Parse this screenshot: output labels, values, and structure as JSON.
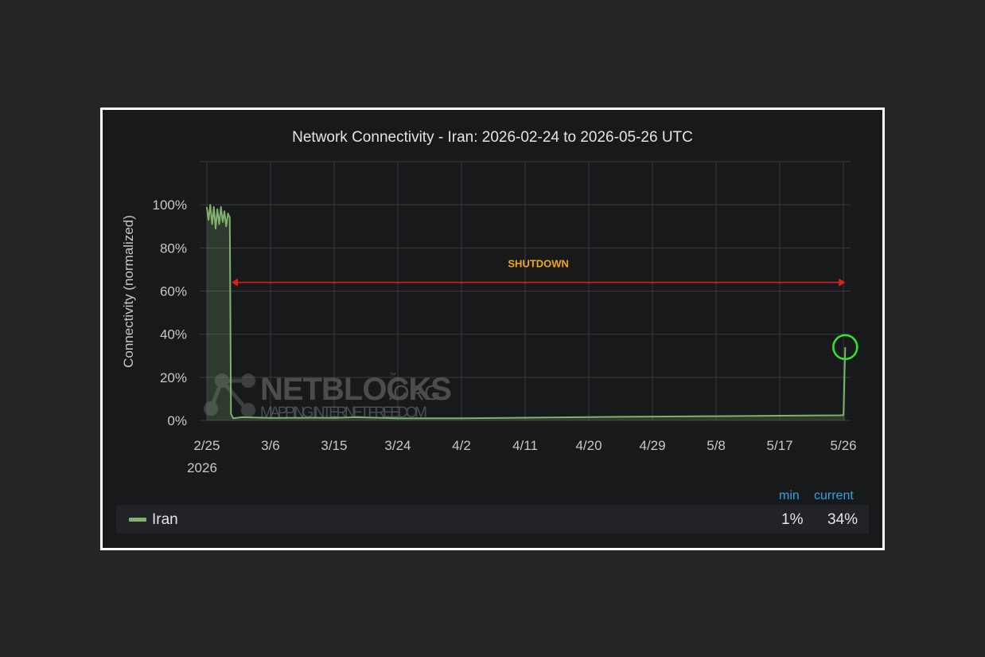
{
  "chart_data": {
    "type": "line",
    "title": "Network Connectivity - Iran: 2026-02-24 to 2026-05-26 UTC",
    "ylabel": "Connectivity (normalized)",
    "xlabel": "",
    "x_tick_labels": [
      "2/25",
      "3/6",
      "3/15",
      "3/24",
      "4/2",
      "4/11",
      "4/20",
      "4/29",
      "5/8",
      "5/17",
      "5/26"
    ],
    "x_year_label": "2026",
    "y_tick_labels": [
      "0%",
      "20%",
      "40%",
      "60%",
      "80%",
      "100%"
    ],
    "ylim": [
      0,
      120
    ],
    "xlim": [
      "2026-02-24",
      "2026-05-27"
    ],
    "grid": true,
    "series": [
      {
        "name": "Iran",
        "color": "#7eb26d",
        "points": [
          [
            "2026-02-25T00:00",
            99
          ],
          [
            "2026-02-25T06:00",
            93
          ],
          [
            "2026-02-25T12:00",
            100
          ],
          [
            "2026-02-25T18:00",
            91
          ],
          [
            "2026-02-26T00:00",
            99
          ],
          [
            "2026-02-26T06:00",
            89
          ],
          [
            "2026-02-26T12:00",
            98
          ],
          [
            "2026-02-26T18:00",
            91
          ],
          [
            "2026-02-27T00:00",
            99
          ],
          [
            "2026-02-27T06:00",
            92
          ],
          [
            "2026-02-27T12:00",
            97
          ],
          [
            "2026-02-27T18:00",
            90
          ],
          [
            "2026-02-28T00:00",
            96
          ],
          [
            "2026-02-28T06:00",
            94
          ],
          [
            "2026-02-28T10:00",
            3
          ],
          [
            "2026-02-28T18:00",
            1
          ],
          [
            "2026-03-02T00:00",
            1.5
          ],
          [
            "2026-03-06T00:00",
            1.2
          ],
          [
            "2026-03-12T00:00",
            1.3
          ],
          [
            "2026-03-15T00:00",
            1.2
          ],
          [
            "2026-03-18T00:00",
            1.5
          ],
          [
            "2026-03-24T00:00",
            1.0
          ],
          [
            "2026-04-02T00:00",
            1.0
          ],
          [
            "2026-04-11T00:00",
            1.3
          ],
          [
            "2026-04-20T00:00",
            1.6
          ],
          [
            "2026-04-29T00:00",
            1.8
          ],
          [
            "2026-05-08T00:00",
            2.0
          ],
          [
            "2026-05-17T00:00",
            2.2
          ],
          [
            "2026-05-25T12:00",
            2.4
          ],
          [
            "2026-05-26T00:00",
            2.5
          ],
          [
            "2026-05-26T06:00",
            34
          ]
        ]
      }
    ],
    "annotation": {
      "label": "SHUTDOWN",
      "start": "2026-02-28T12:00",
      "end": "2026-05-26T06:00",
      "y": 64,
      "arrow_color": "#e0201f",
      "label_color": "#f2a51d"
    },
    "highlight": {
      "x": "2026-05-26T06:00",
      "y": 34,
      "color": "#2ee82e"
    }
  },
  "watermark": {
    "brand": "NETBLOCKS",
    "suffix": ".ORG",
    "tm": "™",
    "tagline": "MAPPING INTERNET FREEDOM"
  },
  "legend": {
    "min_header": "min",
    "current_header": "current",
    "series_label": "Iran",
    "min_value": "1%",
    "current_value": "34%"
  }
}
